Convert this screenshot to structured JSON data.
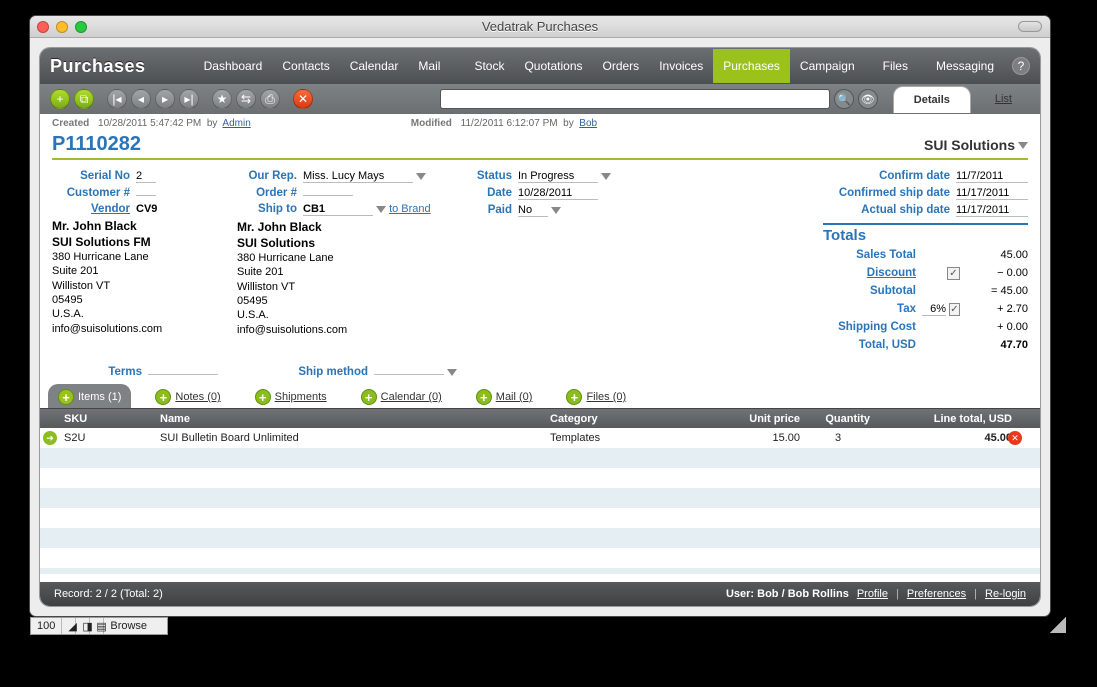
{
  "window_title": "Vedatrak Purchases",
  "brand": "Purchases",
  "nav": {
    "items": [
      "Dashboard",
      "Contacts",
      "Calendar",
      "Mail",
      "Stock",
      "Quotations",
      "Orders",
      "Invoices",
      "Purchases",
      "Campaign",
      "Files",
      "Messaging"
    ],
    "active_index": 8,
    "help": "?"
  },
  "view_tabs": {
    "details": "Details",
    "list": "List"
  },
  "audit": {
    "created_label": "Created",
    "created": "10/28/2011 5:47:42 PM",
    "created_by_label": "by",
    "created_by": "Admin",
    "modified_label": "Modified",
    "modified": "11/2/2011 6:12:07 PM",
    "modified_by_label": "by",
    "modified_by": "Bob"
  },
  "purchase_id": "P1110282",
  "company": "SUI Solutions",
  "left": {
    "serial_label": "Serial No",
    "serial": "2",
    "customer_label": "Customer #",
    "customer": "",
    "vendor_label": "Vendor",
    "vendor": "CV9",
    "addr_name": "Mr. John Black",
    "addr_org": "SUI Solutions FM",
    "addr_l1": "380 Hurricane Lane",
    "addr_l2": "Suite 201",
    "addr_l3": "Williston VT",
    "addr_l4": "05495",
    "addr_l5": "U.S.A.",
    "addr_email": "info@suisolutions.com",
    "terms_label": "Terms",
    "terms": ""
  },
  "mid": {
    "rep_label": "Our Rep.",
    "rep": "Miss. Lucy Mays",
    "order_label": "Order #",
    "order": "",
    "shipto_label": "Ship to",
    "shipto": "CB1",
    "tobrand": "to Brand",
    "addr_name": "Mr. John Black",
    "addr_org": "SUI Solutions",
    "addr_l1": "380 Hurricane Lane",
    "addr_l2": "Suite 201",
    "addr_l3": "Williston VT",
    "addr_l4": "05495",
    "addr_l5": "U.S.A.",
    "addr_email": "info@suisolutions.com",
    "shipmethod_label": "Ship method",
    "shipmethod": ""
  },
  "statuscol": {
    "status_label": "Status",
    "status": "In Progress",
    "date_label": "Date",
    "date": "10/28/2011",
    "paid_label": "Paid",
    "paid": "No"
  },
  "dates": {
    "confirm_label": "Confirm date",
    "confirm": "11/7/2011",
    "confirmed_ship_label": "Confirmed ship date",
    "confirmed_ship": "11/17/2011",
    "actual_ship_label": "Actual ship date",
    "actual_ship": "11/17/2011"
  },
  "totals": {
    "title": "Totals",
    "sales_label": "Sales Total",
    "sales": "45.00",
    "discount_label": "Discount",
    "discount_chk": "✓",
    "discount": "− 0.00",
    "subtotal_label": "Subtotal",
    "subtotal": "= 45.00",
    "tax_label": "Tax",
    "tax_pct": "6%",
    "tax_chk": "✓",
    "tax": "+ 2.70",
    "ship_label": "Shipping Cost",
    "ship": "+ 0.00",
    "total_label": "Total, USD",
    "total": "47.70"
  },
  "subtabs": {
    "items": "Items (1)",
    "notes": "Notes (0)",
    "shipments": "Shipments",
    "calendar": "Calendar (0)",
    "mail": "Mail (0)",
    "files": "Files (0)"
  },
  "grid": {
    "headers": {
      "sku": "SKU",
      "name": "Name",
      "cat": "Category",
      "unit": "Unit price",
      "qty": "Quantity",
      "lt": "Line total, USD"
    },
    "rows": [
      {
        "sku": "S2U",
        "name": "SUI Bulletin Board Unlimited",
        "cat": "Templates",
        "unit": "15.00",
        "qty": "3",
        "lt": "45.00"
      }
    ]
  },
  "footer": {
    "record": "Record: 2 / 2 (Total: 2)",
    "user": "User: Bob / Bob Rollins",
    "profile": "Profile",
    "prefs": "Preferences",
    "relogin": "Re-login"
  },
  "os_status": {
    "zoom": "100",
    "mode": "Browse"
  }
}
